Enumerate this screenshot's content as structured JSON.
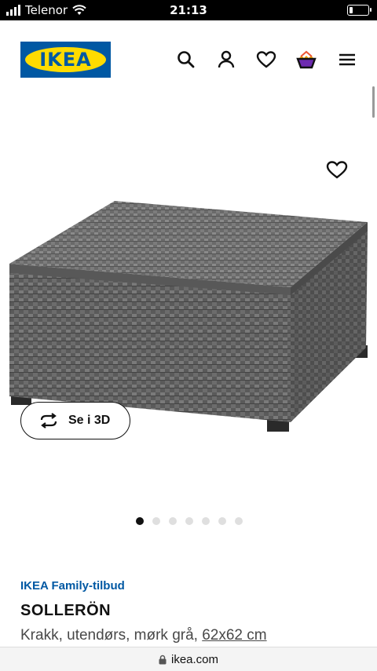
{
  "status": {
    "carrier": "Telenor",
    "time": "21:13"
  },
  "brand": {
    "logo_text": "IKEA",
    "blue": "#0058a3",
    "yellow": "#ffdb00"
  },
  "header_icons": [
    "search-icon",
    "profile-icon",
    "heart-icon",
    "basket-icon",
    "menu-icon"
  ],
  "gallery": {
    "total_images": 7,
    "active_index": 0
  },
  "view_3d": {
    "label": "Se i 3D"
  },
  "product": {
    "family_offer": "IKEA Family-tilbud",
    "name": "SOLLERÖN",
    "description": "Krakk, utendørs, mørk grå, ",
    "size": "62x62 cm"
  },
  "browser": {
    "url": "ikea.com"
  }
}
